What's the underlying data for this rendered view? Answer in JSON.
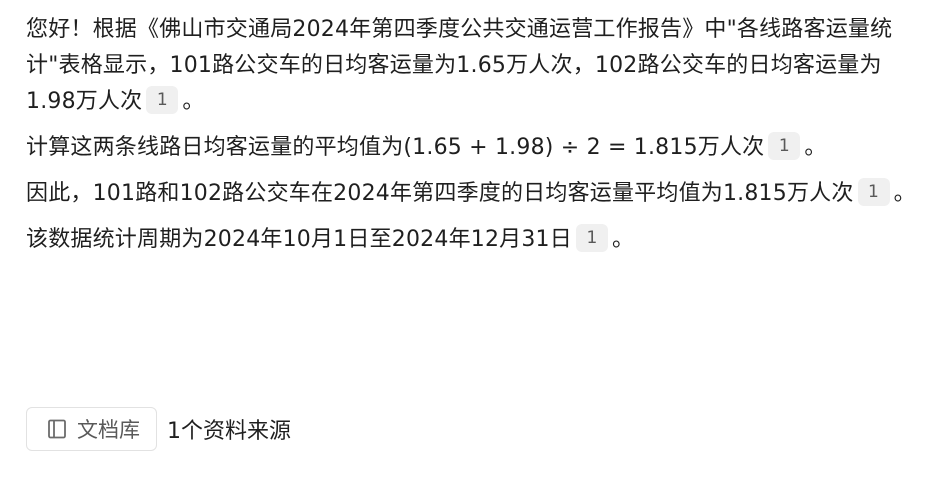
{
  "answer": {
    "p1": {
      "text_a": "您好！根据《佛山市交通局2024年第四季度公共交通运营工作报告》中\"各线路客运量统计\"表格显示，101路公交车的日均客运量为1.65万人次，102路公交车的日均客运量为1.98万人次",
      "cite": "1",
      "tail": "。"
    },
    "p2": {
      "text": "计算这两条线路日均客运量的平均值为(1.65 + 1.98) ÷ 2 = 1.815万人次",
      "cite": "1",
      "tail": "。"
    },
    "p3": {
      "text": "因此，101路和102路公交车在2024年第四季度的日均客运量平均值为1.815万人次",
      "cite": "1",
      "tail": "。"
    },
    "p4": {
      "text": "该数据统计周期为2024年10月1日至2024年12月31日",
      "cite": "1",
      "tail": "。"
    }
  },
  "sources": {
    "button_label": "文档库",
    "button_icon": "book-icon",
    "count_label": "1个资料来源"
  }
}
